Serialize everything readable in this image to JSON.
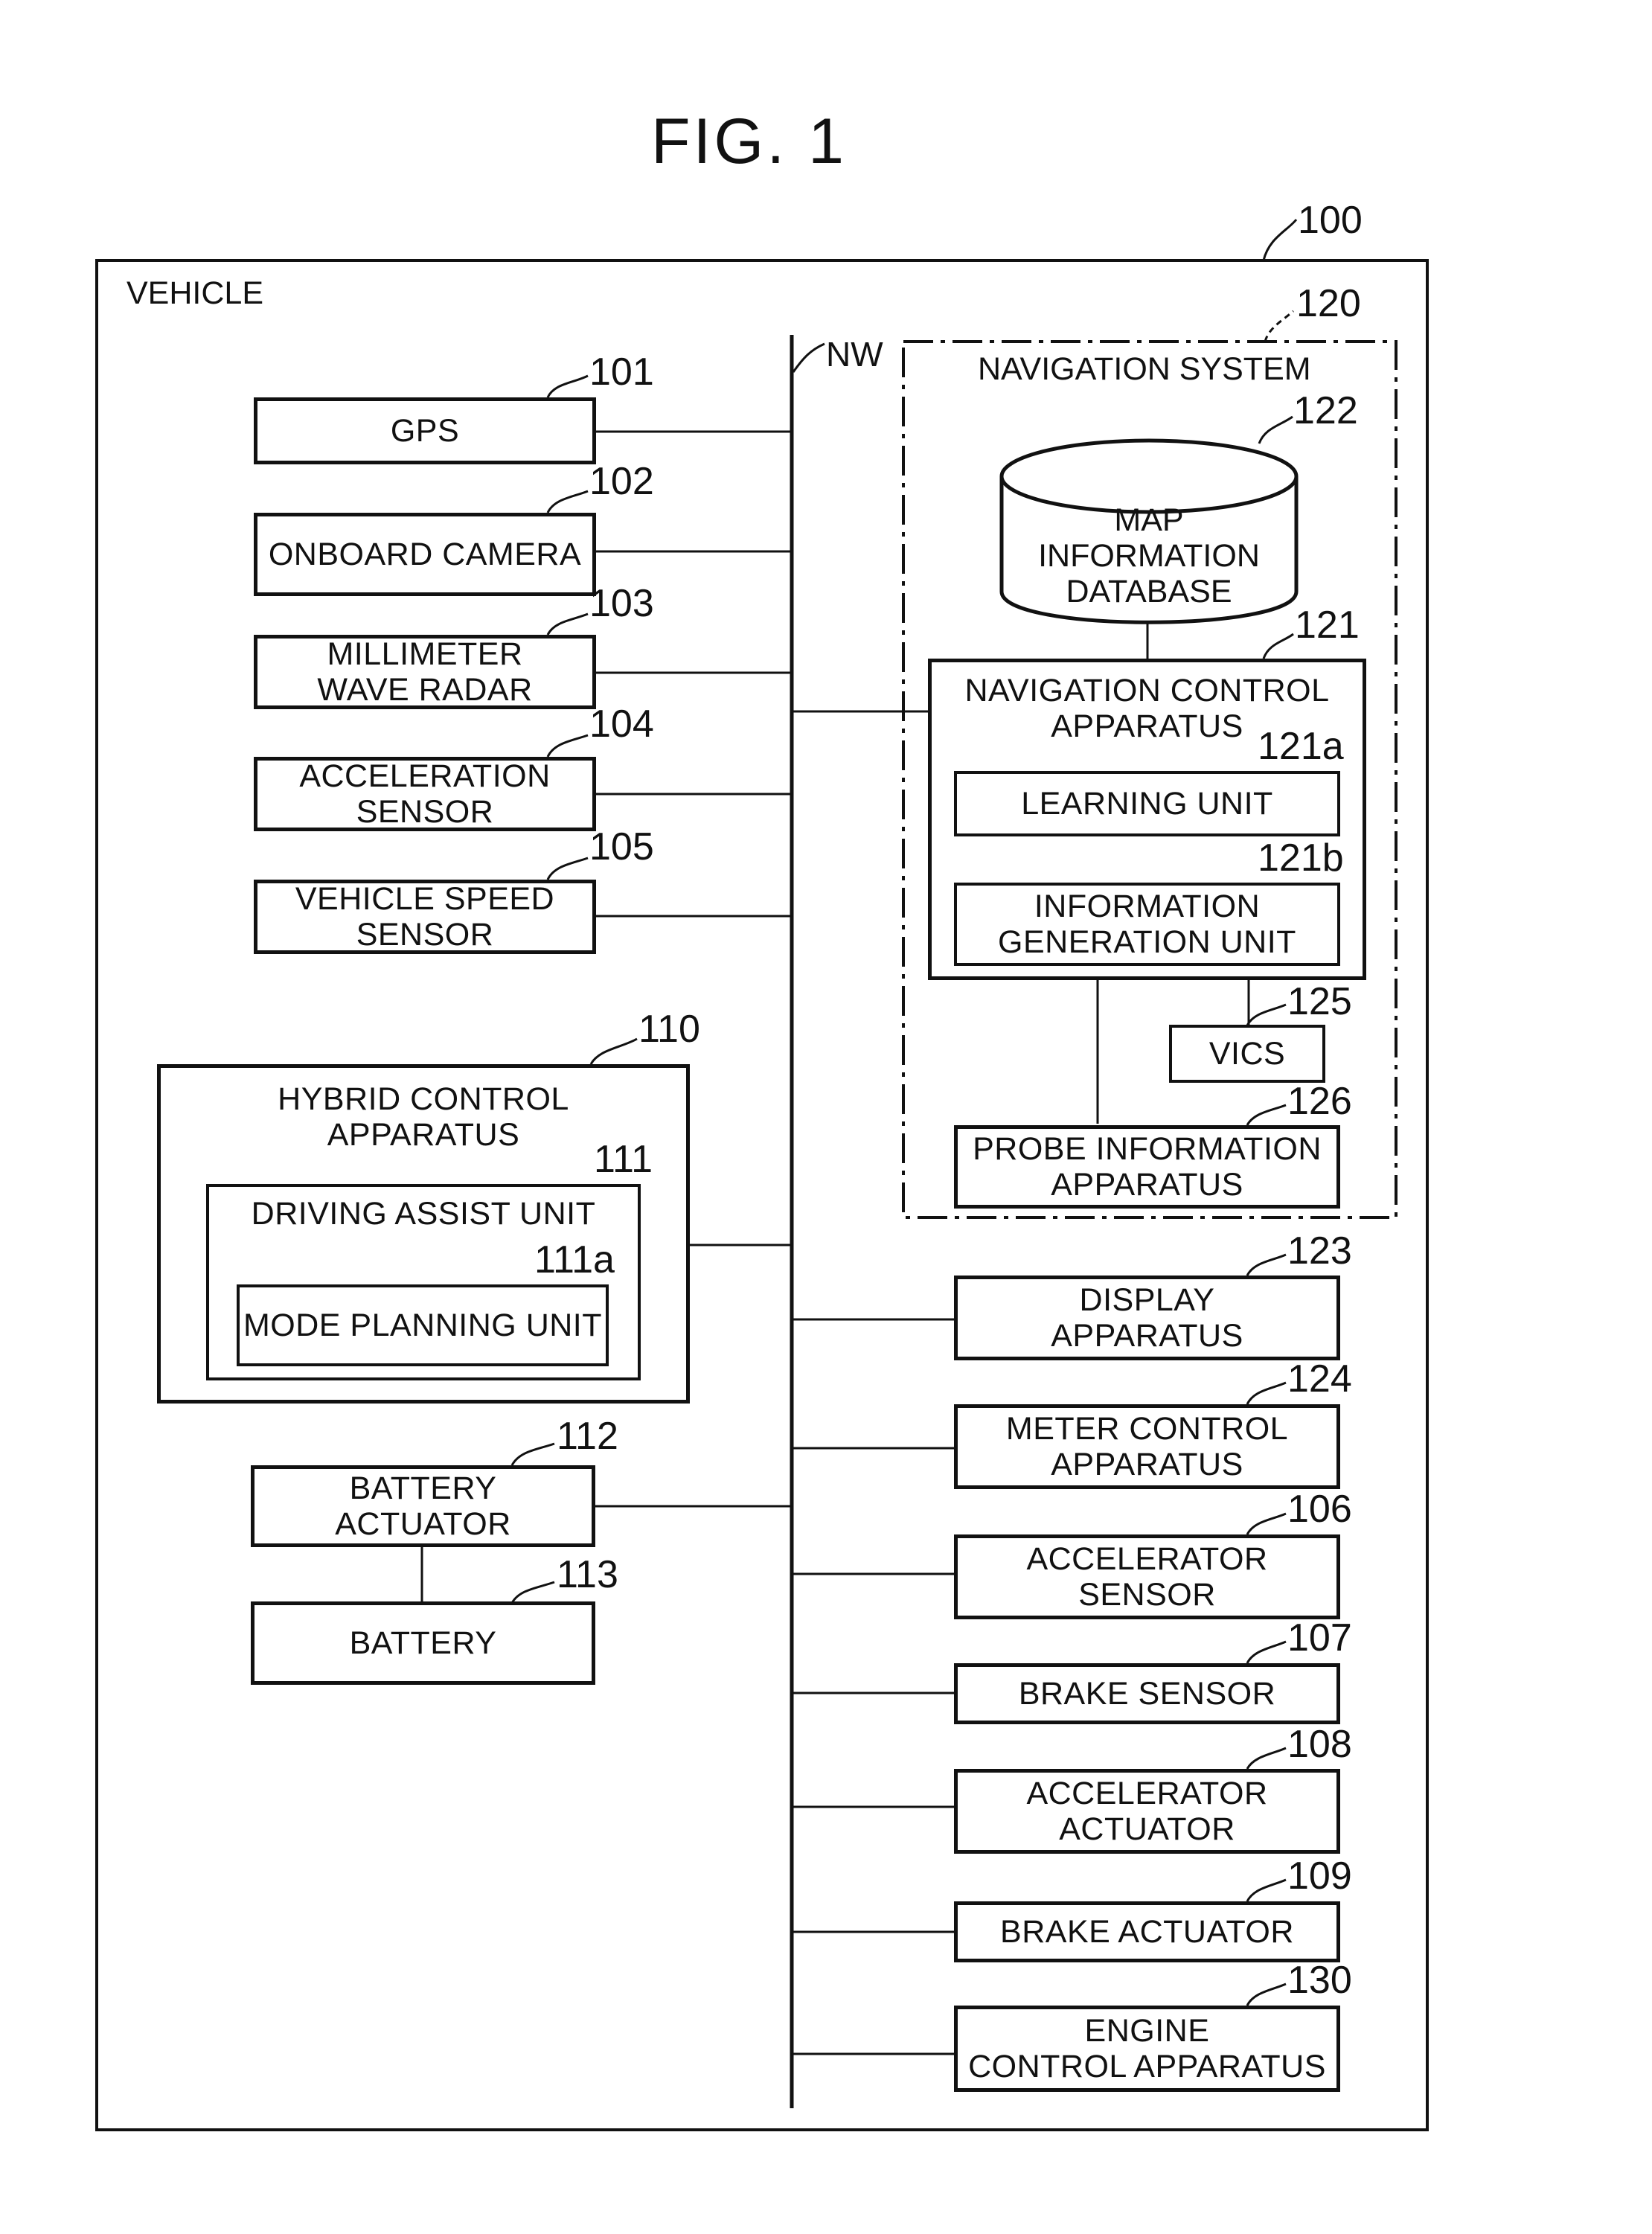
{
  "figure": {
    "title": "FIG. 1"
  },
  "vehicle": {
    "label": "VEHICLE",
    "ref": "100"
  },
  "network": {
    "label": "NW"
  },
  "left_components": [
    {
      "ref": "101",
      "label": "GPS"
    },
    {
      "ref": "102",
      "label": "ONBOARD CAMERA"
    },
    {
      "ref": "103",
      "label": "MILLIMETER\nWAVE RADAR"
    },
    {
      "ref": "104",
      "label": "ACCELERATION\nSENSOR"
    },
    {
      "ref": "105",
      "label": "VEHICLE SPEED\nSENSOR"
    }
  ],
  "hybrid": {
    "ref": "110",
    "label": "HYBRID CONTROL\nAPPARATUS",
    "driving_assist": {
      "ref": "111",
      "label": "DRIVING ASSIST UNIT",
      "mode_planning": {
        "ref": "111a",
        "label": "MODE PLANNING UNIT"
      }
    }
  },
  "battery_actuator": {
    "ref": "112",
    "label": "BATTERY\nACTUATOR"
  },
  "battery": {
    "ref": "113",
    "label": "BATTERY"
  },
  "navigation": {
    "ref": "120",
    "label": "NAVIGATION SYSTEM",
    "map_db": {
      "ref": "122",
      "label": "MAP\nINFORMATION\nDATABASE"
    },
    "nav_control": {
      "ref": "121",
      "label": "NAVIGATION CONTROL\nAPPARATUS",
      "learning": {
        "ref": "121a",
        "label": "LEARNING UNIT"
      },
      "info_gen": {
        "ref": "121b",
        "label": "INFORMATION\nGENERATION UNIT"
      }
    },
    "vics": {
      "ref": "125",
      "label": "VICS"
    },
    "probe": {
      "ref": "126",
      "label": "PROBE INFORMATION\nAPPARATUS"
    }
  },
  "right_components": [
    {
      "ref": "123",
      "label": "DISPLAY\nAPPARATUS"
    },
    {
      "ref": "124",
      "label": "METER CONTROL\nAPPARATUS"
    },
    {
      "ref": "106",
      "label": "ACCELERATOR\nSENSOR"
    },
    {
      "ref": "107",
      "label": "BRAKE SENSOR"
    },
    {
      "ref": "108",
      "label": "ACCELERATOR\nACTUATOR"
    },
    {
      "ref": "109",
      "label": "BRAKE ACTUATOR"
    },
    {
      "ref": "130",
      "label": "ENGINE\nCONTROL APPARATUS"
    }
  ]
}
